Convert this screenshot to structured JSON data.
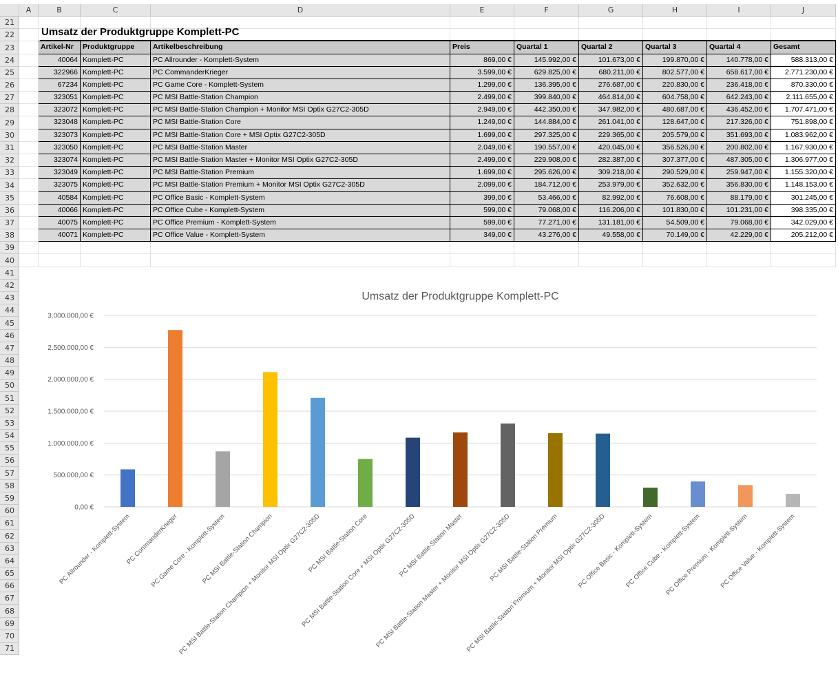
{
  "columns": [
    "A",
    "B",
    "C",
    "D",
    "E",
    "F",
    "G",
    "H",
    "I",
    "J"
  ],
  "rows": [
    "21",
    "22",
    "23",
    "24",
    "25",
    "26",
    "27",
    "28",
    "29",
    "30",
    "31",
    "32",
    "33",
    "34",
    "35",
    "36",
    "37",
    "38",
    "39",
    "40",
    "41",
    "42",
    "43",
    "44",
    "45",
    "46",
    "47",
    "48",
    "49",
    "50",
    "51",
    "52",
    "53",
    "54",
    "55",
    "56",
    "57",
    "58",
    "59",
    "60",
    "61",
    "62",
    "63",
    "64",
    "65",
    "66",
    "67",
    "68",
    "69",
    "70",
    "71"
  ],
  "sheet_title": "Umsatz der Produktgruppe Komplett-PC",
  "table": {
    "headers": [
      "Artikel-Nr",
      "Produktgruppe",
      "Artikelbeschreibung",
      "Preis",
      "Quartal 1",
      "Quartal 2",
      "Quartal 3",
      "Quartal 4",
      "Gesamt"
    ],
    "rows": [
      [
        "40064",
        "Komplett-PC",
        "PC Allrounder - Komplett-System",
        "869,00 €",
        "145.992,00 €",
        "101.673,00 €",
        "199.870,00 €",
        "140.778,00 €",
        "588.313,00 €"
      ],
      [
        "322966",
        "Komplett-PC",
        "PC CommanderKrieger",
        "3.599,00 €",
        "629.825,00 €",
        "680.211,00 €",
        "802.577,00 €",
        "658.617,00 €",
        "2.771.230,00 €"
      ],
      [
        "67234",
        "Komplett-PC",
        "PC Game Core - Komplett-System",
        "1.299,00 €",
        "136.395,00 €",
        "276.687,00 €",
        "220.830,00 €",
        "236.418,00 €",
        "870.330,00 €"
      ],
      [
        "323051",
        "Komplett-PC",
        "PC MSI Battle-Station Champion",
        "2.499,00 €",
        "399.840,00 €",
        "464.814,00 €",
        "604.758,00 €",
        "642.243,00 €",
        "2.111.655,00 €"
      ],
      [
        "323072",
        "Komplett-PC",
        "PC MSI Battle-Station Champion + Monitor MSI Optix G27C2-305D",
        "2.949,00 €",
        "442.350,00 €",
        "347.982,00 €",
        "480.687,00 €",
        "436.452,00 €",
        "1.707.471,00 €"
      ],
      [
        "323048",
        "Komplett-PC",
        "PC MSI Battle-Station Core",
        "1.249,00 €",
        "144.884,00 €",
        "261.041,00 €",
        "128.647,00 €",
        "217.326,00 €",
        "751.898,00 €"
      ],
      [
        "323073",
        "Komplett-PC",
        "PC MSI Battle-Station Core + MSI Optix G27C2-305D",
        "1.699,00 €",
        "297.325,00 €",
        "229.365,00 €",
        "205.579,00 €",
        "351.693,00 €",
        "1.083.962,00 €"
      ],
      [
        "323050",
        "Komplett-PC",
        "PC MSI Battle-Station Master",
        "2.049,00 €",
        "190.557,00 €",
        "420.045,00 €",
        "356.526,00 €",
        "200.802,00 €",
        "1.167.930,00 €"
      ],
      [
        "323074",
        "Komplett-PC",
        "PC MSI Battle-Station Master + Monitor MSI Optix G27C2-305D",
        "2.499,00 €",
        "229.908,00 €",
        "282.387,00 €",
        "307.377,00 €",
        "487.305,00 €",
        "1.306.977,00 €"
      ],
      [
        "323049",
        "Komplett-PC",
        "PC MSI Battle-Station Premium",
        "1.699,00 €",
        "295.626,00 €",
        "309.218,00 €",
        "290.529,00 €",
        "259.947,00 €",
        "1.155.320,00 €"
      ],
      [
        "323075",
        "Komplett-PC",
        "PC MSI Battle-Station Premium + Monitor MSI Optix G27C2-305D",
        "2.099,00 €",
        "184.712,00 €",
        "253.979,00 €",
        "352.632,00 €",
        "356.830,00 €",
        "1.148.153,00 €"
      ],
      [
        "40584",
        "Komplett-PC",
        "PC Office Basic - Komplett-System",
        "399,00 €",
        "53.466,00 €",
        "82.992,00 €",
        "76.608,00 €",
        "88.179,00 €",
        "301.245,00 €"
      ],
      [
        "40066",
        "Komplett-PC",
        "PC Office Cube - Komplett-System",
        "599,00 €",
        "79.068,00 €",
        "116.206,00 €",
        "101.830,00 €",
        "101.231,00 €",
        "398.335,00 €"
      ],
      [
        "40075",
        "Komplett-PC",
        "PC Office Premium - Komplett-System",
        "599,00 €",
        "77.271,00 €",
        "131.181,00 €",
        "54.509,00 €",
        "79.068,00 €",
        "342.029,00 €"
      ],
      [
        "40071",
        "Komplett-PC",
        "PC Office Value - Komplett-System",
        "349,00 €",
        "43.276,00 €",
        "49.558,00 €",
        "70.149,00 €",
        "42.229,00 €",
        "205.212,00 €"
      ]
    ]
  },
  "chart_data": {
    "type": "bar",
    "title": "Umsatz der Produktgruppe Komplett-PC",
    "xlabel": "",
    "ylabel": "",
    "ylim": [
      0,
      3000000
    ],
    "yticks": [
      0,
      500000,
      1000000,
      1500000,
      2000000,
      2500000,
      3000000
    ],
    "ytick_labels": [
      "0,00 €",
      "500.000,00 €",
      "1.000.000,00 €",
      "1.500.000,00 €",
      "2.000.000,00 €",
      "2.500.000,00 €",
      "3.000.000,00 €"
    ],
    "grid": true,
    "legend": "none",
    "categories": [
      "PC Allrounder - Komplett-System",
      "PC CommanderKrieger",
      "PC Game Core - Komplett-System",
      "PC MSI Battle-Station Champion",
      "PC MSI Battle-Station Champion + Monitor MSI Optix G27C2-305D",
      "PC MSI Battle-Station Core",
      "PC MSI Battle-Station Core + MSI Optix G27C2-305D",
      "PC MSI Battle-Station Master",
      "PC MSI Battle-Station Master + Monitor MSI Optix G27C2-305D",
      "PC MSI Battle-Station Premium",
      "PC MSI Battle-Station Premium + Monitor MSI Optix G27C2-305D",
      "PC Office Basic - Komplett-System",
      "PC Office Cube - Komplett-System",
      "PC Office Premium - Komplett-System",
      "PC Office Value - Komplett-System"
    ],
    "values": [
      588313,
      2771230,
      870330,
      2111655,
      1707471,
      751898,
      1083962,
      1167930,
      1306977,
      1155320,
      1148153,
      301245,
      398335,
      342029,
      205212
    ],
    "colors": [
      "#4472c4",
      "#ed7d31",
      "#a5a5a5",
      "#ffc000",
      "#5b9bd5",
      "#70ad47",
      "#264478",
      "#9e480e",
      "#636363",
      "#997300",
      "#255e91",
      "#43682b",
      "#698ed0",
      "#f1975a",
      "#b7b7b7"
    ]
  }
}
